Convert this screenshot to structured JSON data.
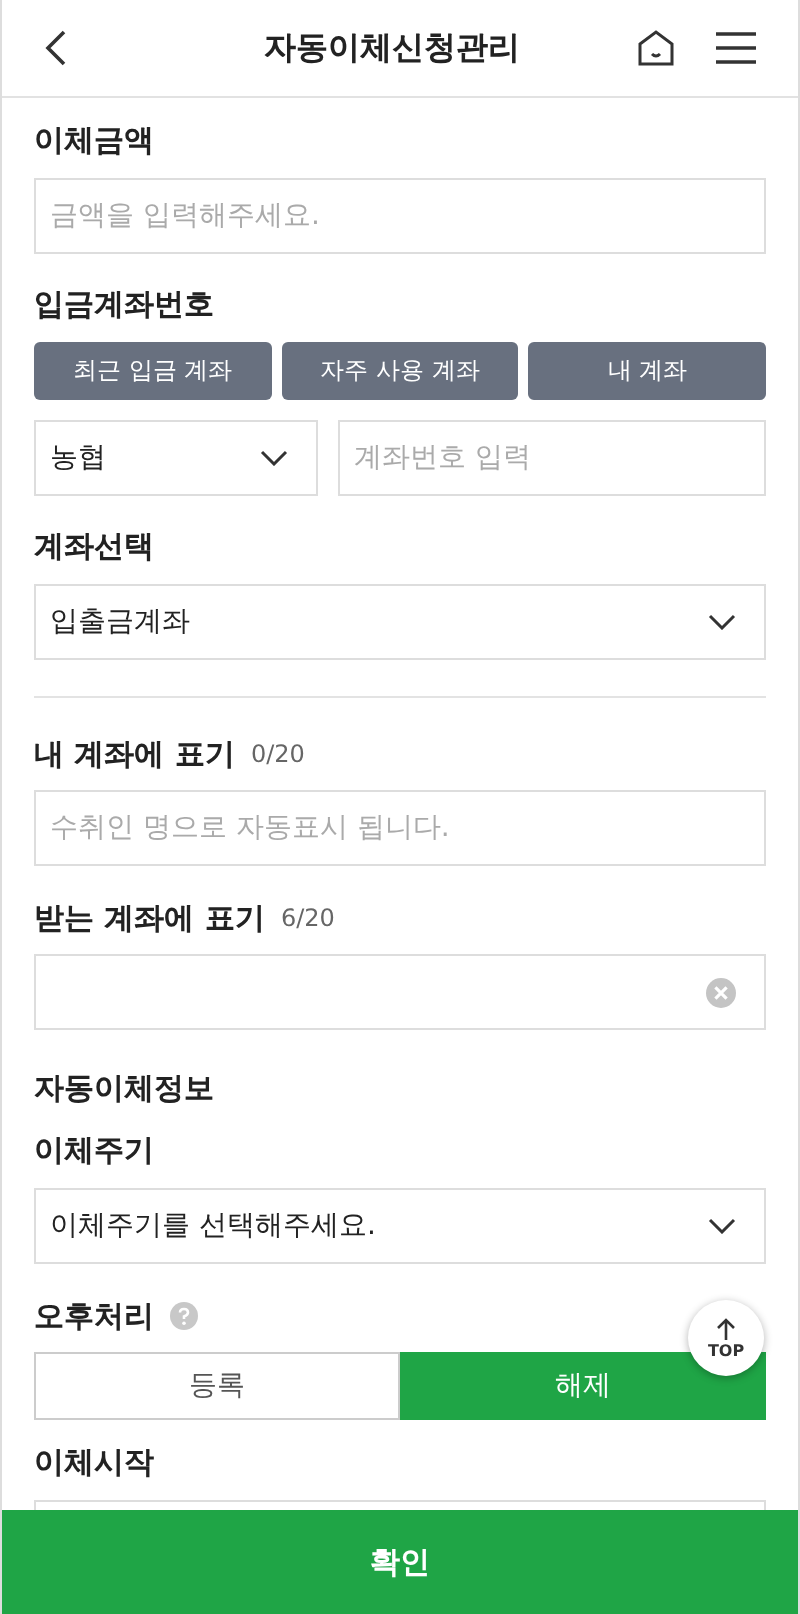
{
  "header": {
    "title": "자동이체신청관리"
  },
  "amount": {
    "label": "이체금액",
    "placeholder": "금액을 입력해주세요."
  },
  "deposit_account": {
    "label": "입금계좌번호",
    "tabs": [
      "최근 입금 계좌",
      "자주 사용 계좌",
      "내 계좌"
    ],
    "bank": "농협",
    "account_placeholder": "계좌번호 입력"
  },
  "account_select": {
    "label": "계좌선택",
    "value": "입출금계좌"
  },
  "my_memo": {
    "label": "내 계좌에 표기",
    "count": "0/20",
    "placeholder": "수취인 명으로 자동표시 됩니다."
  },
  "their_memo": {
    "label": "받는 계좌에 표기",
    "count": "6/20"
  },
  "section_title": "자동이체정보",
  "cycle": {
    "label": "이체주기",
    "value": "이체주기를 선택해주세요."
  },
  "afternoon": {
    "label": "오후처리",
    "options": [
      {
        "label": "등록",
        "selected": false
      },
      {
        "label": "해제",
        "selected": true
      }
    ]
  },
  "start": {
    "label": "이체시작"
  },
  "top_button": "TOP",
  "confirm": "확인"
}
